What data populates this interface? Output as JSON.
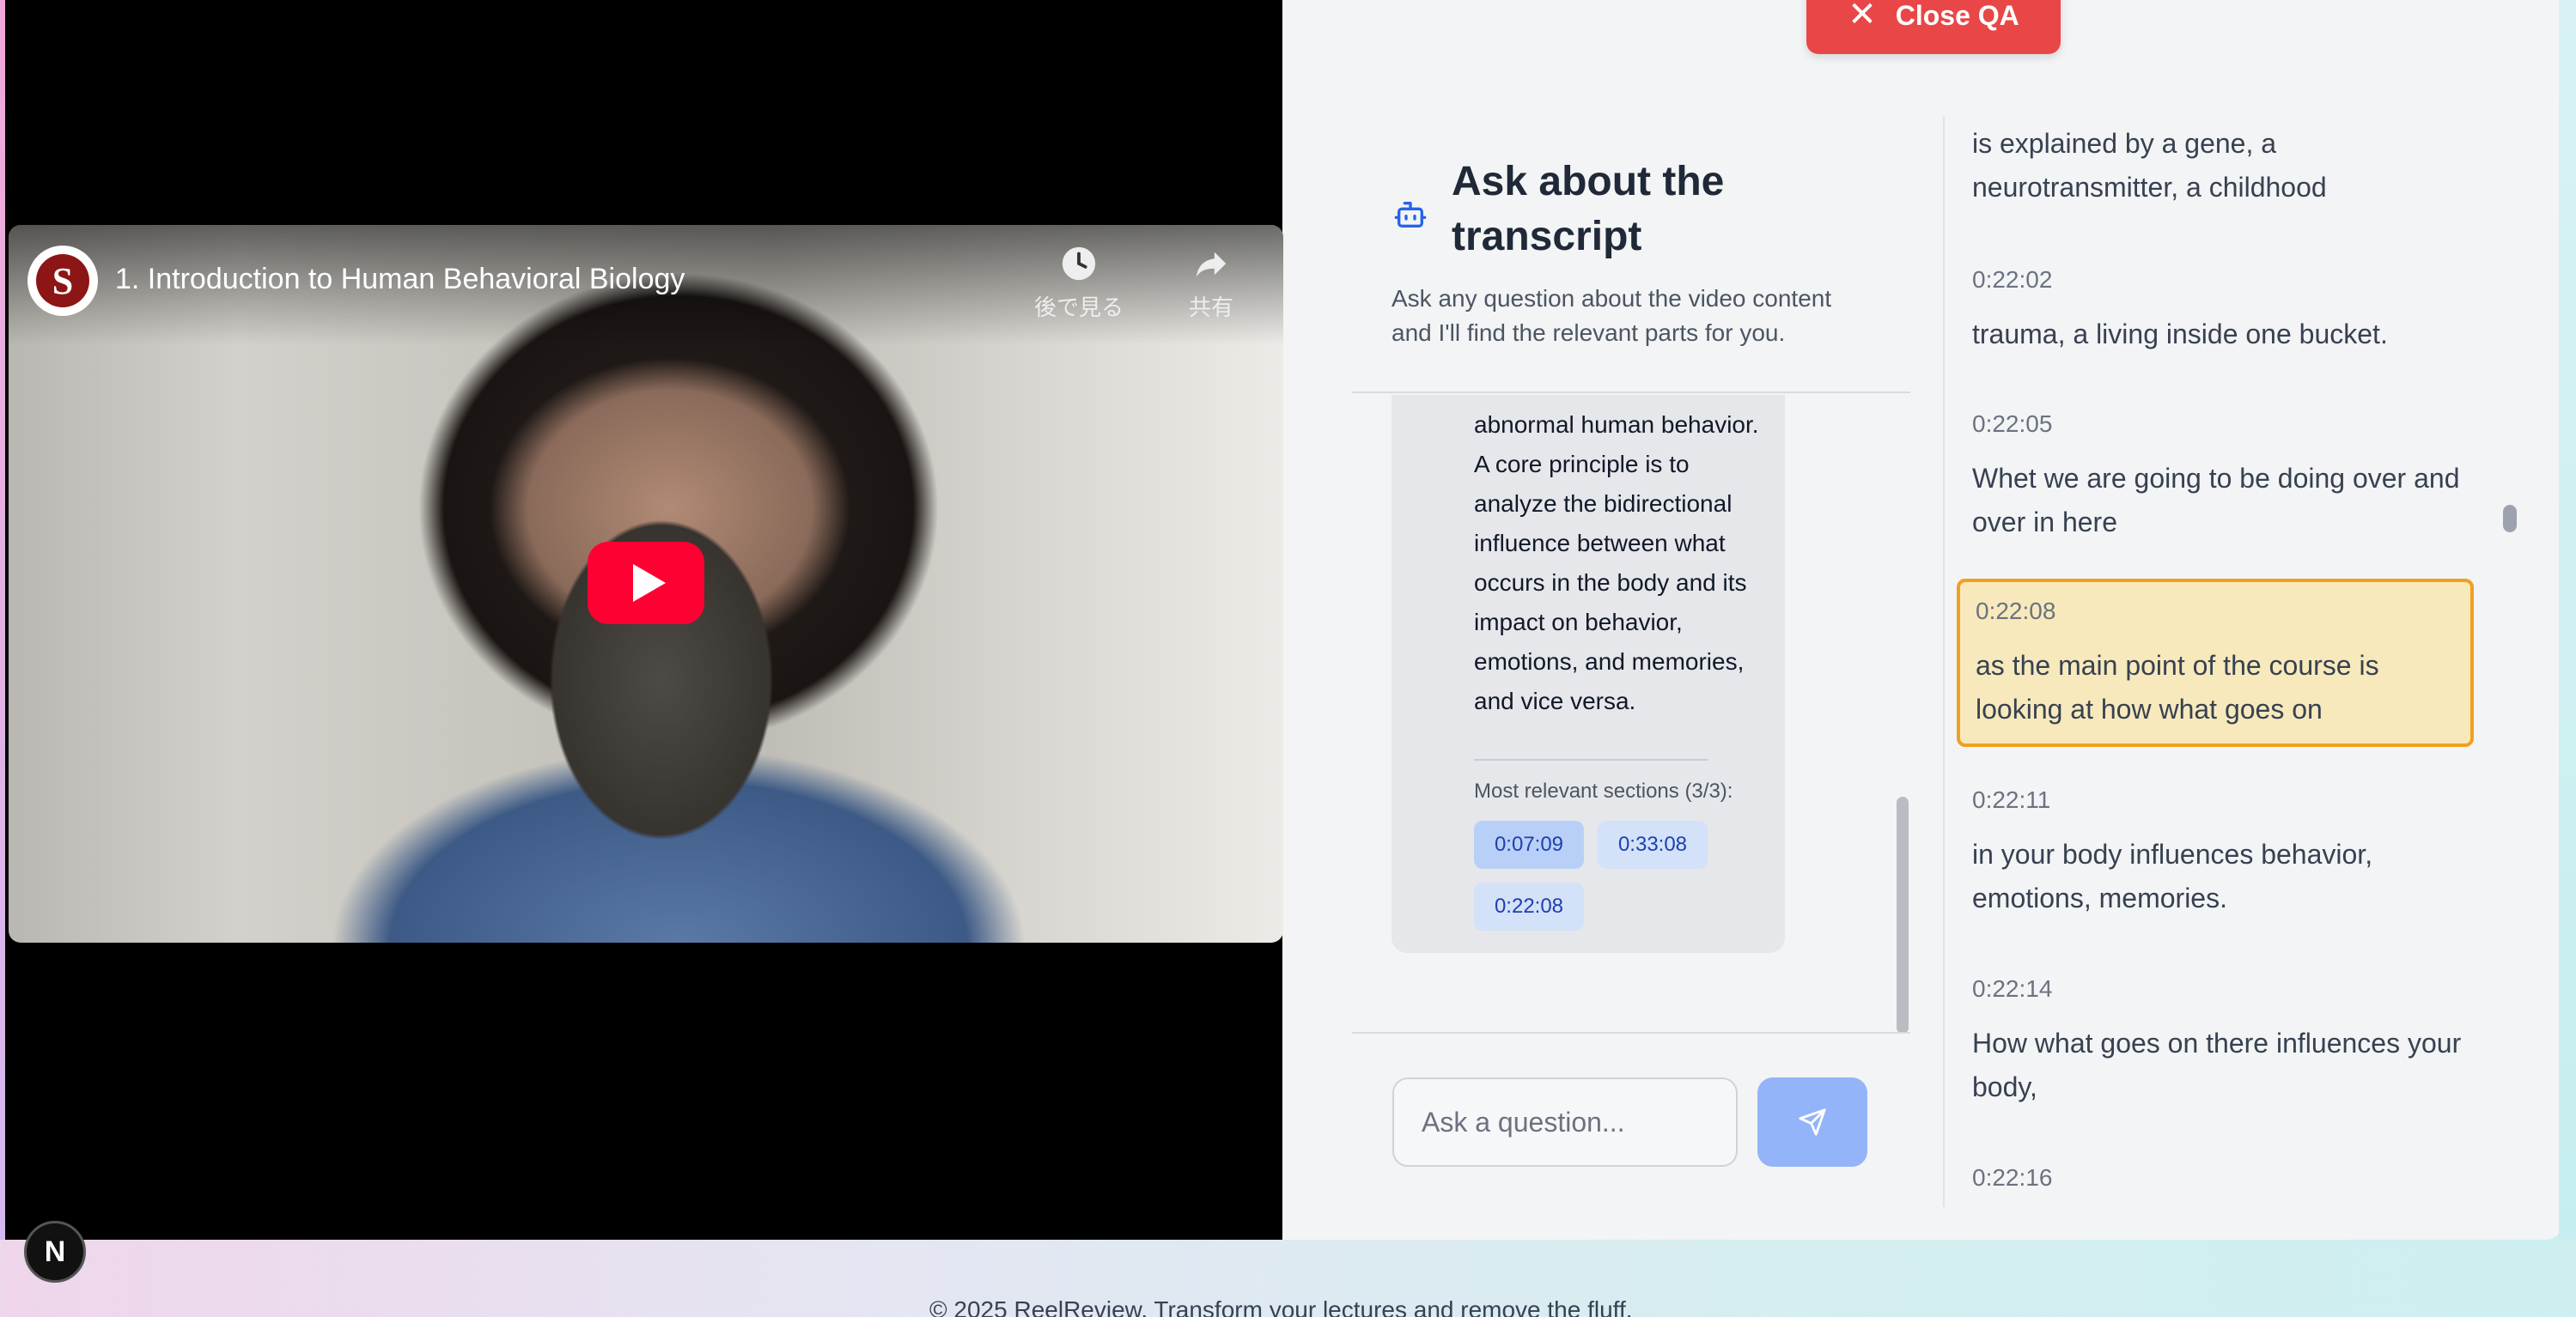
{
  "video": {
    "title": "1. Introduction to Human Behavioral Biology",
    "channel_logo_letter": "S",
    "watch_later_label": "後で見る",
    "share_label": "共有"
  },
  "overlay": {
    "dev_badge": "N"
  },
  "qa": {
    "close_label": "Close QA",
    "title": "Ask about the transcript",
    "subtitle": "Ask any question about the video content and I'll find the relevant parts for you.",
    "answer_text": "abnormal human behavior. A core principle is to analyze the bidirectional influence between what occurs in the body and its impact on behavior, emotions, and memories, and vice versa.",
    "sections_label": "Most relevant sections (3/3):",
    "chips": [
      "0:07:09",
      "0:33:08",
      "0:22:08"
    ],
    "input_placeholder": "Ask a question..."
  },
  "transcript": {
    "entries": [
      {
        "time": "",
        "text": "is explained by a gene, a neurotransmitter, a childhood"
      },
      {
        "time": "0:22:02",
        "text": "trauma, a living inside one bucket."
      },
      {
        "time": "0:22:05",
        "text": "Whet we are going to be doing over and over in here"
      },
      {
        "time": "0:22:08",
        "text": "as the main point of the course is looking at how what goes on",
        "active": true
      },
      {
        "time": "0:22:11",
        "text": "in your body influences behavior, emotions, memories."
      },
      {
        "time": "0:22:14",
        "text": "How what goes on there influences your body,"
      },
      {
        "time": "0:22:16",
        "text": ""
      }
    ]
  },
  "footer": {
    "text": "© 2025 ReelReview. Transform your lectures and remove the fluff."
  },
  "colors": {
    "close_button": "#e94747",
    "active_highlight": "#f7e9bb",
    "active_border": "#f0a020",
    "chip_bg": "#cfe0fb",
    "send_button": "#93b4f8"
  }
}
